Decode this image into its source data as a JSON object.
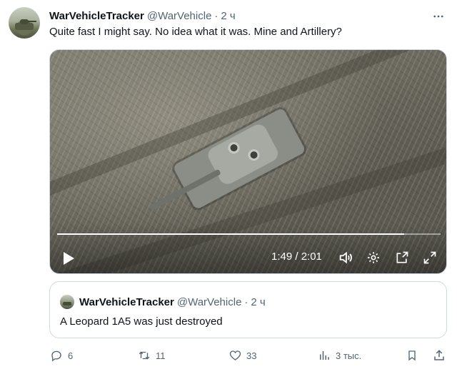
{
  "tweet": {
    "display_name": "WarVehicleTracker",
    "handle": "@WarVehicle",
    "separator": "·",
    "time": "2 ч",
    "text": "Quite fast I might say. No idea what it was. Mine and Artillery?"
  },
  "video": {
    "timecode": "1:49 / 2:01",
    "progress_fraction": 0.905
  },
  "quoted_tweet": {
    "display_name": "WarVehicleTracker",
    "handle": "@WarVehicle",
    "separator": "·",
    "time": "2 ч",
    "text": "A Leopard 1A5 was just destroyed"
  },
  "actions": {
    "replies": "6",
    "retweets": "11",
    "likes": "33",
    "views": "3 тыс."
  },
  "icons": {
    "more": "more-icon",
    "play": "play-icon",
    "volume": "volume-icon",
    "settings": "gear-icon",
    "pip": "pip-icon",
    "fullscreen": "fullscreen-icon",
    "reply": "reply-icon",
    "retweet": "retweet-icon",
    "like": "heart-icon",
    "views": "views-icon",
    "bookmark": "bookmark-icon",
    "share": "share-icon"
  },
  "colors": {
    "text_primary": "#0f1419",
    "text_secondary": "#536471",
    "border": "#cfd9de"
  }
}
